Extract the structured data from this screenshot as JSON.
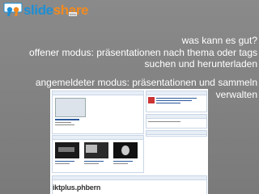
{
  "logo": {
    "word1": "slide",
    "word2": "share",
    "beta": "beta"
  },
  "slide": {
    "question": "was kann es gut?",
    "line1": "offener modus: präsentationen nach thema oder tags",
    "line2": "suchen und herunterladen",
    "line3": "angemeldeter modus: präsentationen  und sammeln",
    "line4": "verwalten"
  },
  "screenshot": {
    "brand": "iktplus.phbern"
  },
  "colors": {
    "background": "#7d7d7d",
    "text": "#ffffff",
    "logo_blue": "#1d8fd6",
    "logo_orange": "#f28a1f"
  }
}
